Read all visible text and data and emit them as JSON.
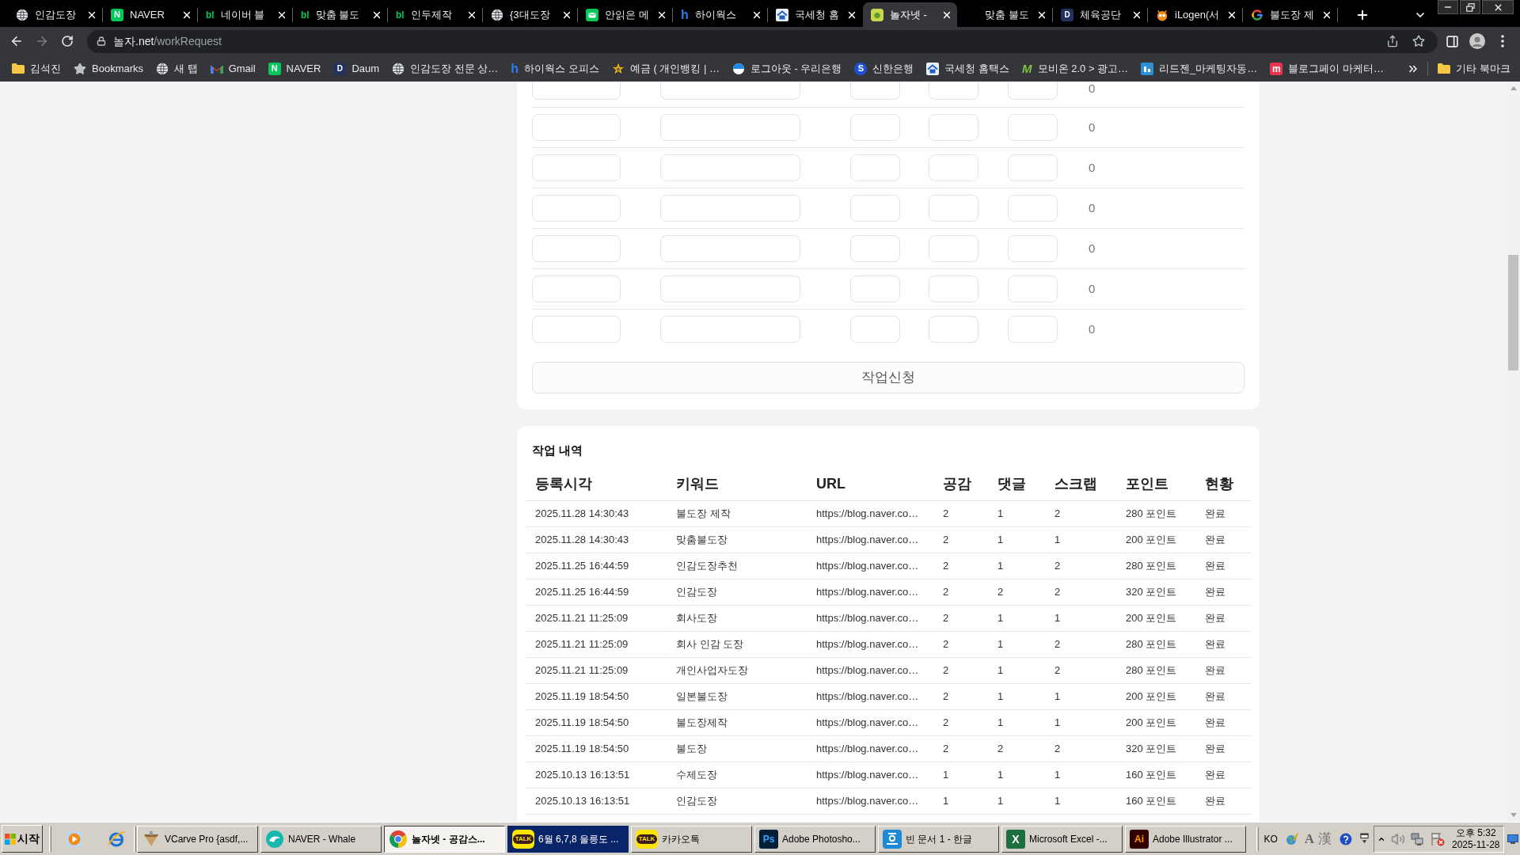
{
  "browser": {
    "tabs": [
      {
        "title": "인감도장",
        "selected": false
      },
      {
        "title": "NAVER",
        "glyph": "N",
        "selected": false
      },
      {
        "title": "네이버 블",
        "glyph": "bl",
        "selected": false
      },
      {
        "title": "맞춤 불도",
        "glyph": "bl",
        "selected": false
      },
      {
        "title": "인두제작",
        "glyph": "bl",
        "selected": false
      },
      {
        "title": "{3대도장",
        "selected": false
      },
      {
        "title": "안읽은 메",
        "selected": false
      },
      {
        "title": "하이웍스",
        "glyph": "h",
        "selected": false
      },
      {
        "title": "국세청 홈",
        "selected": false
      },
      {
        "title": "놀자넷 -",
        "selected": true
      },
      {
        "title": "맞춤 불도",
        "selected": false
      },
      {
        "title": "체육공단",
        "glyph": "D",
        "selected": false
      },
      {
        "title": "iLogen(서",
        "selected": false
      },
      {
        "title": "불도장 제",
        "selected": false
      }
    ],
    "forward_enabled": false,
    "address": {
      "host": "놀자.net",
      "path": "/workRequest"
    },
    "bookmarks": [
      {
        "label": "김석진"
      },
      {
        "label": "Bookmarks"
      },
      {
        "label": "새 탭"
      },
      {
        "label": "Gmail"
      },
      {
        "label": "NAVER",
        "glyph": "N"
      },
      {
        "label": "Daum",
        "glyph": "D"
      },
      {
        "label": "인감도장 전문 상…"
      },
      {
        "label": "하이웍스 오피스",
        "glyph": "h"
      },
      {
        "label": "예금 ( 개인뱅킹 | …"
      },
      {
        "label": "로그아웃 - 우리은행"
      },
      {
        "label": "신한은행",
        "glyph": "S"
      },
      {
        "label": "국세청 홈택스"
      },
      {
        "label": "모비온 2.0 > 광고…",
        "glyph": "M"
      },
      {
        "label": "리드젠_마케팅자동…"
      },
      {
        "label": "블로그페이 마케터…",
        "glyph": "m"
      }
    ],
    "other_bookmarks": "기타 북마크"
  },
  "request_form": {
    "rows": [
      {
        "total": "0"
      },
      {
        "total": "0"
      },
      {
        "total": "0"
      },
      {
        "total": "0"
      },
      {
        "total": "0"
      },
      {
        "total": "0"
      },
      {
        "total": "0"
      }
    ],
    "submit": "작업신청"
  },
  "history": {
    "title": "작업 내역",
    "columns": [
      "등록시각",
      "키워드",
      "URL",
      "공감",
      "댓글",
      "스크랩",
      "포인트",
      "현황"
    ],
    "rows": [
      [
        "2025.11.28 14:30:43",
        "불도장 제작",
        "https://blog.naver.co…",
        "2",
        "1",
        "2",
        "280 포인트",
        "완료"
      ],
      [
        "2025.11.28 14:30:43",
        "맞춤불도장",
        "https://blog.naver.co…",
        "2",
        "1",
        "1",
        "200 포인트",
        "완료"
      ],
      [
        "2025.11.25 16:44:59",
        "인감도장추천",
        "https://blog.naver.co…",
        "2",
        "1",
        "2",
        "280 포인트",
        "완료"
      ],
      [
        "2025.11.25 16:44:59",
        "인감도장",
        "https://blog.naver.co…",
        "2",
        "2",
        "2",
        "320 포인트",
        "완료"
      ],
      [
        "2025.11.21 11:25:09",
        "회사도장",
        "https://blog.naver.co…",
        "2",
        "1",
        "1",
        "200 포인트",
        "완료"
      ],
      [
        "2025.11.21 11:25:09",
        "회사 인감 도장",
        "https://blog.naver.co…",
        "2",
        "1",
        "2",
        "280 포인트",
        "완료"
      ],
      [
        "2025.11.21 11:25:09",
        "개인사업자도장",
        "https://blog.naver.co…",
        "2",
        "1",
        "2",
        "280 포인트",
        "완료"
      ],
      [
        "2025.11.19 18:54:50",
        "일본불도장",
        "https://blog.naver.co…",
        "2",
        "1",
        "1",
        "200 포인트",
        "완료"
      ],
      [
        "2025.11.19 18:54:50",
        "불도장제작",
        "https://blog.naver.co…",
        "2",
        "1",
        "1",
        "200 포인트",
        "완료"
      ],
      [
        "2025.11.19 18:54:50",
        "불도장",
        "https://blog.naver.co…",
        "2",
        "2",
        "2",
        "320 포인트",
        "완료"
      ],
      [
        "2025.10.13 16:13:51",
        "수제도장",
        "https://blog.naver.co…",
        "1",
        "1",
        "1",
        "160 포인트",
        "완료"
      ],
      [
        "2025.10.13 16:13:51",
        "인감도장",
        "https://blog.naver.co…",
        "1",
        "1",
        "1",
        "160 포인트",
        "완료"
      ]
    ]
  },
  "taskbar": {
    "start": "시작",
    "tasks": [
      {
        "label": "VCarve Pro {asdf,...",
        "selected": false,
        "attention": false
      },
      {
        "label": "NAVER - Whale",
        "selected": false,
        "attention": false
      },
      {
        "label": "놀자넷 - 공감스...",
        "selected": true,
        "attention": false
      },
      {
        "label": "6월 6,7,8 울릉도 ...",
        "glyph": "TALK",
        "selected": false,
        "attention": true
      },
      {
        "label": "카카오톡",
        "glyph": "TALK",
        "selected": false,
        "attention": false
      },
      {
        "label": "Adobe Photosho...",
        "glyph": "Ps",
        "selected": false,
        "attention": false
      },
      {
        "label": "빈 문서 1 - 한글",
        "selected": false,
        "attention": false
      },
      {
        "label": "Microsoft Excel -...",
        "glyph": "X",
        "selected": false,
        "attention": false
      },
      {
        "label": "Adobe Illustrator ...",
        "glyph": "Ai",
        "selected": false,
        "attention": false
      }
    ],
    "language": "KO",
    "ime_mode": "A",
    "hanja": "漢",
    "time": "오후 5:32",
    "date": "2025-11-28"
  }
}
